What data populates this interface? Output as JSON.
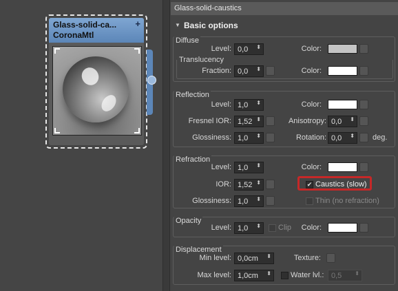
{
  "node": {
    "title_line1": "Glass-solid-ca...",
    "title_line2": "CoronaMtl",
    "plus_glyph": "+",
    "header_color": "#6f97c6"
  },
  "panel": {
    "title": "Glass-solid-caustics",
    "rollout_arrow": "▼",
    "rollout_title": "Basic options"
  },
  "spinner_glyph": "⬍",
  "diffuse": {
    "group_label": "Diffuse",
    "level_label": "Level:",
    "level_value": "0,0",
    "color_label": "Color:",
    "color_value": "#c4c4c4",
    "translucency_label": "Translucency",
    "fraction_label": "Fraction:",
    "fraction_value": "0,0",
    "trans_color_label": "Color:",
    "trans_color_value": "#ffffff"
  },
  "reflection": {
    "group_label": "Reflection",
    "level_label": "Level:",
    "level_value": "1,0",
    "color_label": "Color:",
    "color_value": "#ffffff",
    "fresnel_label": "Fresnel IOR:",
    "fresnel_value": "1,52",
    "anisotropy_label": "Anisotropy:",
    "anisotropy_value": "0,0",
    "glossiness_label": "Glossiness:",
    "glossiness_value": "1,0",
    "rotation_label": "Rotation:",
    "rotation_value": "0,0",
    "deg_label": "deg."
  },
  "refraction": {
    "group_label": "Refraction",
    "level_label": "Level:",
    "level_value": "1,0",
    "color_label": "Color:",
    "color_value": "#ffffff",
    "ior_label": "IOR:",
    "ior_value": "1,52",
    "caustics_label": "Caustics (slow)",
    "caustics_checked": true,
    "glossiness_label": "Glossiness:",
    "glossiness_value": "1,0",
    "thin_label": "Thin (no refraction)",
    "thin_checked": false
  },
  "opacity": {
    "group_label": "Opacity",
    "level_label": "Level:",
    "level_value": "1,0",
    "clip_label": "Clip",
    "color_label": "Color:",
    "color_value": "#ffffff"
  },
  "displacement": {
    "group_label": "Displacement",
    "min_label": "Min level:",
    "min_value": "0,0cm",
    "texture_label": "Texture:",
    "max_label": "Max level:",
    "max_value": "1,0cm",
    "water_label": "Water lvl.:",
    "water_value": "0,5"
  }
}
